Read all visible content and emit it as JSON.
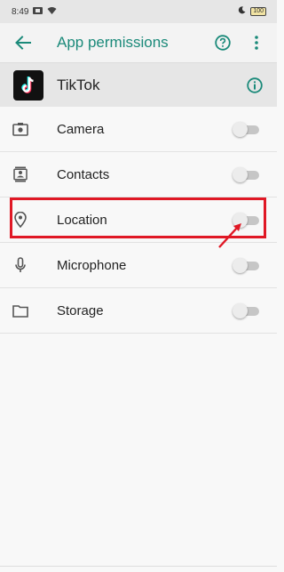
{
  "status_bar": {
    "time": "8:49",
    "battery": "100"
  },
  "app_bar": {
    "title": "App permissions"
  },
  "app_header": {
    "name": "TikTok"
  },
  "permissions": [
    {
      "label": "Camera",
      "icon": "camera-icon",
      "enabled": false
    },
    {
      "label": "Contacts",
      "icon": "contacts-icon",
      "enabled": false
    },
    {
      "label": "Location",
      "icon": "location-icon",
      "enabled": false
    },
    {
      "label": "Microphone",
      "icon": "microphone-icon",
      "enabled": false
    },
    {
      "label": "Storage",
      "icon": "folder-icon",
      "enabled": false
    }
  ],
  "colors": {
    "accent": "#1b8a7a",
    "highlight": "#e01825"
  }
}
